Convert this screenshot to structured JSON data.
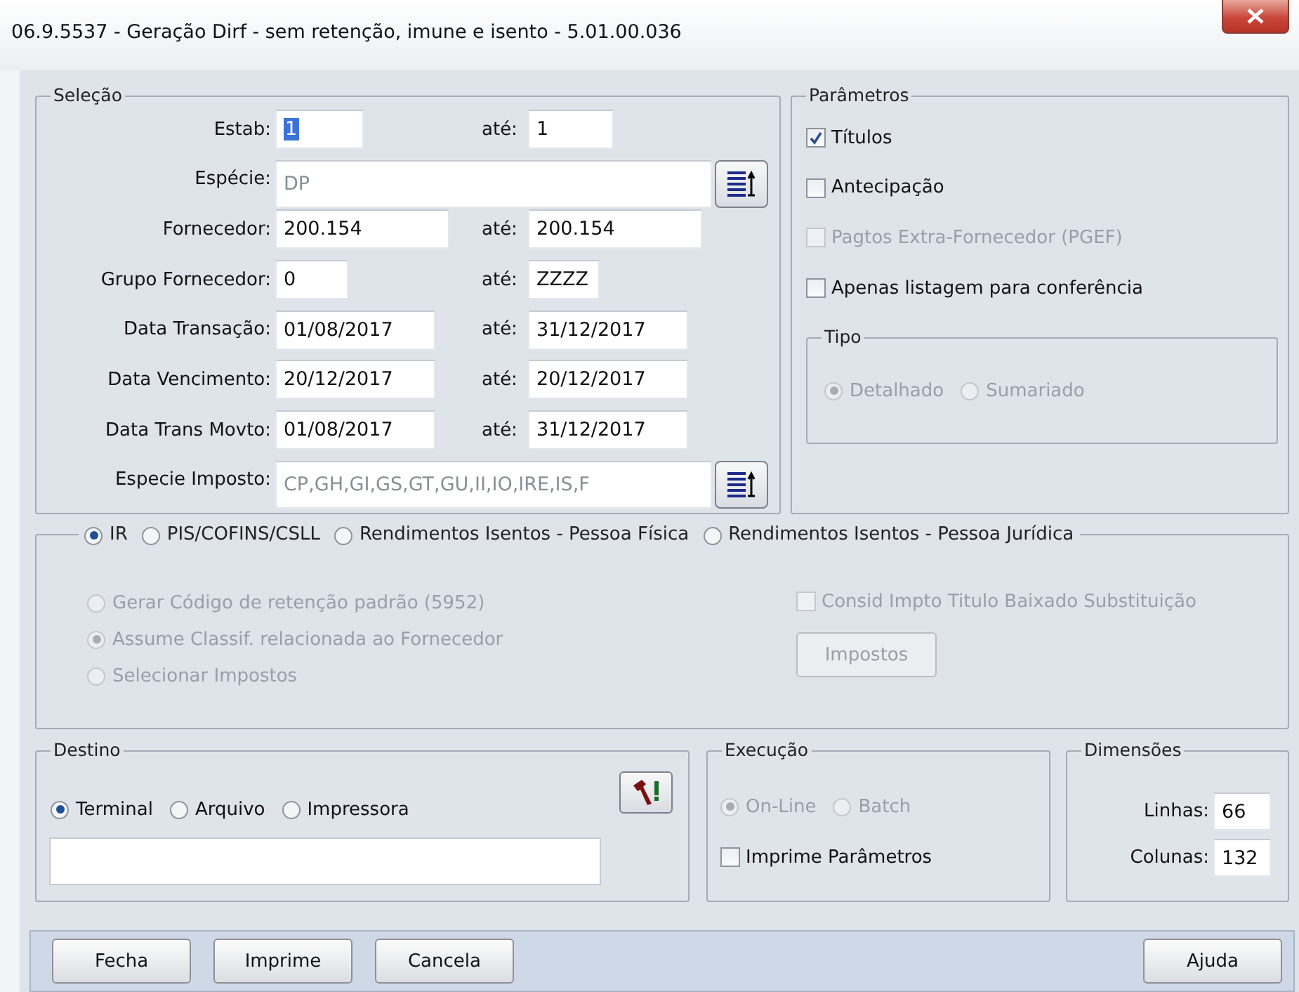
{
  "window": {
    "title": "06.9.5537 - Geração Dirf - sem retenção, imune e isento - 5.01.00.036"
  },
  "selecao": {
    "title": "Seleção",
    "rows": [
      {
        "kind": "range",
        "label": "Estab:",
        "value": "1",
        "text_selected": true,
        "until_label": "até:",
        "until_value": "1"
      },
      {
        "kind": "list",
        "label": "Espécie:",
        "value": "DP",
        "disabled": true
      },
      {
        "kind": "range",
        "label": "Fornecedor:",
        "value": "200.154",
        "text_selected": false,
        "until_label": "até:",
        "until_value": "200.154"
      },
      {
        "kind": "range",
        "label": "Grupo Fornecedor:",
        "value": "0",
        "text_selected": false,
        "until_label": "até:",
        "until_value": "ZZZZ"
      },
      {
        "kind": "range",
        "label": "Data Transação:",
        "value": "01/08/2017",
        "text_selected": false,
        "until_label": "até:",
        "until_value": "31/12/2017"
      },
      {
        "kind": "range",
        "label": "Data Vencimento:",
        "value": "20/12/2017",
        "text_selected": false,
        "until_label": "até:",
        "until_value": "20/12/2017"
      },
      {
        "kind": "range",
        "label": "Data Trans Movto:",
        "value": "01/08/2017",
        "text_selected": false,
        "until_label": "até:",
        "until_value": "31/12/2017"
      },
      {
        "kind": "list",
        "label": "Especie Imposto:",
        "value": "CP,GH,GI,GS,GT,GU,II,IO,IRE,IS,F",
        "disabled": true
      }
    ]
  },
  "parametros": {
    "title": "Parâmetros",
    "options": [
      {
        "label": "Títulos",
        "checked": true,
        "disabled": false
      },
      {
        "label": "Antecipação",
        "checked": false,
        "disabled": false
      },
      {
        "label": "Pagtos Extra-Fornecedor (PGEF)",
        "checked": false,
        "disabled": true
      },
      {
        "label": "Apenas listagem para conferência",
        "checked": false,
        "disabled": false
      }
    ],
    "tipo": {
      "title": "Tipo",
      "options": [
        {
          "label": "Detalhado",
          "selected": true,
          "disabled": true
        },
        {
          "label": "Sumariado",
          "selected": false,
          "disabled": true
        }
      ]
    }
  },
  "imposto": {
    "modes": [
      {
        "label": "IR",
        "selected": true
      },
      {
        "label": "PIS/COFINS/CSLL",
        "selected": false
      },
      {
        "label": "Rendimentos Isentos - Pessoa Física",
        "selected": false
      },
      {
        "label": "Rendimentos Isentos - Pessoa Jurídica",
        "selected": false
      }
    ],
    "options": [
      {
        "label": "Gerar Código de retenção padrão (5952)",
        "selected": false,
        "disabled": true
      },
      {
        "label": "Assume Classif. relacionada ao Fornecedor",
        "selected": true,
        "disabled": true
      },
      {
        "label": "Selecionar Impostos",
        "selected": false,
        "disabled": true
      }
    ],
    "consid": {
      "label": "Consid Impto Titulo Baixado Substituição",
      "checked": false,
      "disabled": true
    },
    "impostos_button": {
      "label": "Impostos",
      "disabled": true
    }
  },
  "destino": {
    "title": "Destino",
    "options": [
      {
        "label": "Terminal",
        "selected": true
      },
      {
        "label": "Arquivo",
        "selected": false
      },
      {
        "label": "Impressora",
        "selected": false
      }
    ]
  },
  "execucao": {
    "title": "Execução",
    "modes": [
      {
        "label": "On-Line",
        "selected": true,
        "disabled": true
      },
      {
        "label": "Batch",
        "selected": false,
        "disabled": true
      }
    ],
    "print_params": {
      "label": "Imprime Parâmetros",
      "checked": false
    }
  },
  "dimensoes": {
    "title": "Dimensões",
    "fields": [
      {
        "label": "Linhas:",
        "value": "66"
      },
      {
        "label": "Colunas:",
        "value": "132"
      }
    ]
  },
  "buttons": [
    {
      "label": "Fecha"
    },
    {
      "label": "Imprime"
    },
    {
      "label": "Cancela"
    },
    {
      "label": "Ajuda"
    }
  ]
}
